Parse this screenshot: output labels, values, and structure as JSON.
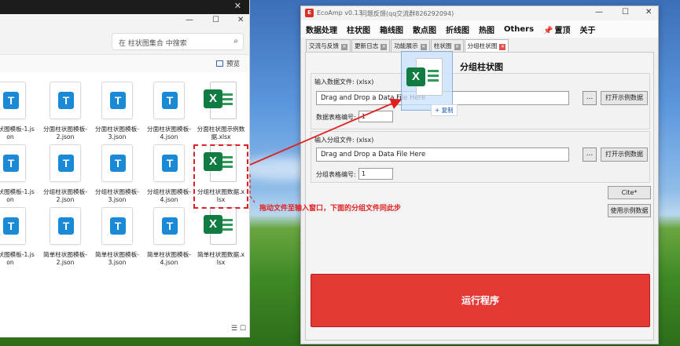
{
  "explorer": {
    "search_placeholder": "在 柱状图集合 中搜索",
    "preview_label": "预览",
    "files": [
      {
        "name": "面柱状图模板-1.json",
        "type": "json"
      },
      {
        "name": "分面柱状图模板-2.json",
        "type": "json"
      },
      {
        "name": "分面柱状图模板-3.json",
        "type": "json"
      },
      {
        "name": "分面柱状图模板-4.json",
        "type": "json"
      },
      {
        "name": "分面柱状图示例数据.xlsx",
        "type": "xlsx"
      },
      {
        "name": "组柱状图模板-1.json",
        "type": "json"
      },
      {
        "name": "分组柱状图模板-2.json",
        "type": "json"
      },
      {
        "name": "分组柱状图模板-3.json",
        "type": "json"
      },
      {
        "name": "分组柱状图模板-4.json",
        "type": "json"
      },
      {
        "name": "分组柱状图数据.xlsx",
        "type": "xlsx"
      },
      {
        "name": "单柱状图模板-1.json",
        "type": "json"
      },
      {
        "name": "简单柱状图模板-2.json",
        "type": "json"
      },
      {
        "name": "简单柱状图模板-3.json",
        "type": "json"
      },
      {
        "name": "简单柱状图模板-4.json",
        "type": "json"
      },
      {
        "name": "简单柱状图数据.xlsx",
        "type": "xlsx"
      }
    ]
  },
  "eco": {
    "logo": "E",
    "title": "EcoAmp v0.13",
    "subtitle": "问题反馈(qq交流群826292094)",
    "menu": [
      "数据处理",
      "柱状图",
      "箱线图",
      "散点图",
      "折线图",
      "热图",
      "Others",
      "置顶",
      "关于"
    ],
    "tabs": [
      "交流与反馈",
      "更新日志",
      "功能展示",
      "柱状图",
      "分组柱状图"
    ],
    "heading": "分组柱状图",
    "data_label": "输入数据文件: (xlsx)",
    "data_value": "Drag and Drop a Data File Here",
    "data_sheet_label": "数据表格编号:",
    "data_sheet_value": "1",
    "group_label": "输入分组文件: (xlsx)",
    "group_value": "Drag and Drop a Data File Here",
    "group_sheet_label": "分组表格编号:",
    "group_sheet_value": "1",
    "browse_label": "...",
    "open_example_label": "打开示例数据",
    "cite_label": "Cite*",
    "use_example_label": "使用示例数据",
    "run_label": "运行程序"
  },
  "drag": {
    "copy_tip": "+ 复制"
  },
  "annotation": "拖动文件至输入窗口，下面的分组文件同此步",
  "colors": {
    "accent_red": "#e53935",
    "excel_green": "#107c41",
    "json_blue": "#1a8ad7"
  }
}
